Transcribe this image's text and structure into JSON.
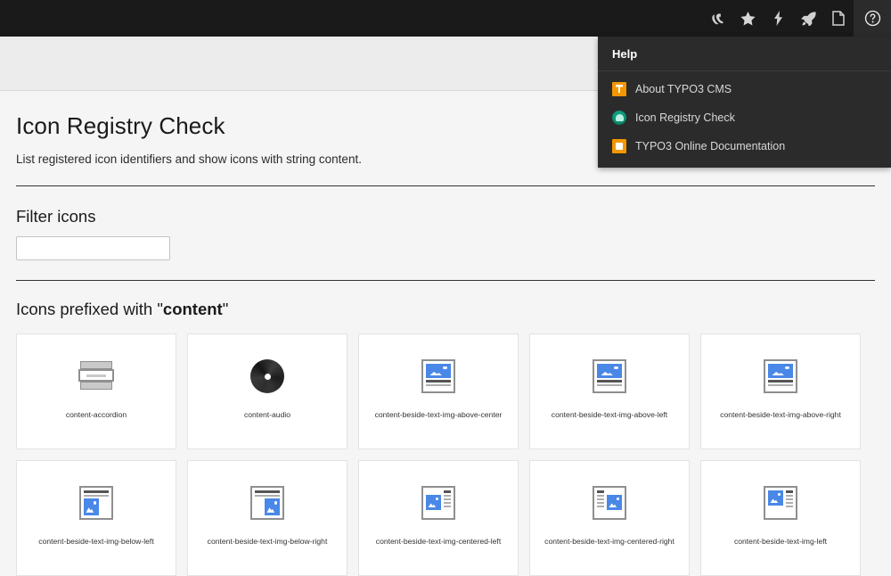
{
  "topbar": {
    "buttons": [
      {
        "name": "typo3-logo-icon",
        "label": "TYPO3"
      },
      {
        "name": "bookmark-star-icon",
        "label": "Bookmarks"
      },
      {
        "name": "flash-lightning-icon",
        "label": "Clear cache"
      },
      {
        "name": "rocket-icon",
        "label": "View webpage"
      },
      {
        "name": "page-document-icon",
        "label": "Page"
      },
      {
        "name": "help-question-icon",
        "label": "Help"
      }
    ]
  },
  "dropdown": {
    "title": "Help",
    "items": [
      {
        "label": "About TYPO3 CMS",
        "icon": "typo3-logo-icon"
      },
      {
        "label": "Icon Registry Check",
        "icon": "icon-registry-icon"
      },
      {
        "label": "TYPO3 Online Documentation",
        "icon": "documentation-icon"
      }
    ]
  },
  "module": {
    "title": "Icon Registry Check",
    "description": "List registered icon identifiers and show icons with string content.",
    "filter_label": "Filter icons",
    "filter_value": "",
    "filter_placeholder": "",
    "section_prefix_before": "Icons prefixed with \"",
    "section_prefix_bold": "content",
    "section_prefix_after": "\"",
    "icons": [
      {
        "label": "content-accordion",
        "type": "accordion"
      },
      {
        "label": "content-audio",
        "type": "audio"
      },
      {
        "label": "content-beside-text-img-above-center",
        "type": "img-above"
      },
      {
        "label": "content-beside-text-img-above-left",
        "type": "img-above"
      },
      {
        "label": "content-beside-text-img-above-right",
        "type": "img-above"
      },
      {
        "label": "content-beside-text-img-below-left",
        "type": "img-below-left"
      },
      {
        "label": "content-beside-text-img-below-right",
        "type": "img-below-right"
      },
      {
        "label": "content-beside-text-img-centered-left",
        "type": "img-centered-left"
      },
      {
        "label": "content-beside-text-img-centered-right",
        "type": "img-centered-right"
      },
      {
        "label": "content-beside-text-img-left",
        "type": "img-centered-left"
      }
    ]
  },
  "colors": {
    "topbar_bg": "#1a1a1a",
    "dropdown_bg": "#2b2b2b",
    "docheader_bg": "#ececec",
    "body_bg": "#f5f5f5",
    "brand_orange": "#f49700",
    "registry_teal": "#0e9e7e",
    "thumb_blue": "#4a88e8"
  }
}
